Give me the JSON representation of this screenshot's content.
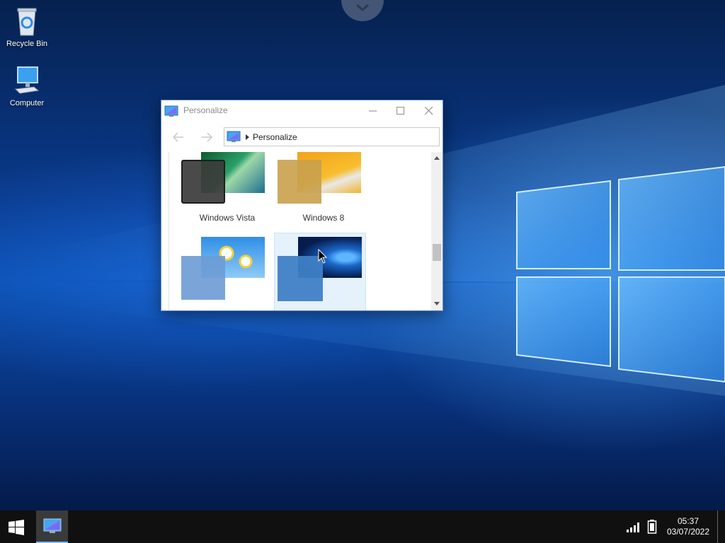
{
  "desktop": {
    "icons": [
      {
        "label": "Recycle Bin",
        "icon": "recycle-bin-icon"
      },
      {
        "label": "Computer",
        "icon": "computer-icon"
      }
    ]
  },
  "window": {
    "title": "Personalize",
    "breadcrumb": "Personalize",
    "themes": [
      {
        "label": "Windows Vista",
        "swatch_color": "#3b3b3b"
      },
      {
        "label": "Windows 8",
        "swatch_color": "#c9a04d"
      },
      {
        "label": "",
        "swatch_color": "#6d9bd4"
      },
      {
        "label": "",
        "swatch_color": "#3f7fc6",
        "selected": true
      }
    ]
  },
  "taskbar": {
    "time": "05:37",
    "date": "03/07/2022"
  },
  "colors": {
    "accent": "#0078d7",
    "taskbar": "#101010",
    "selection": "#e5f1fb"
  }
}
